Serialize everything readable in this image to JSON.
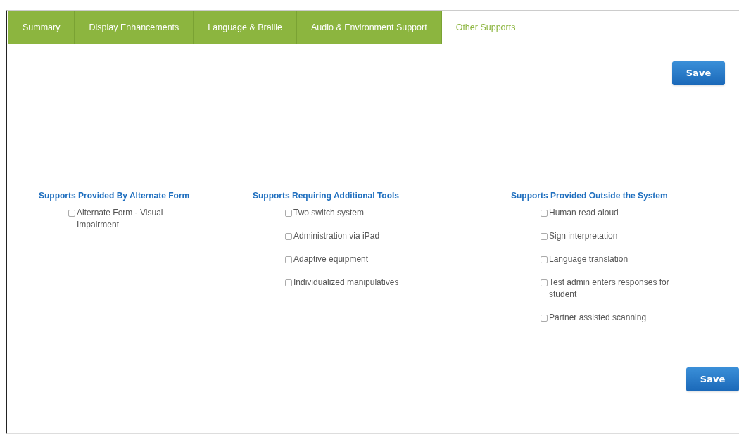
{
  "tabs": [
    {
      "label": "Summary",
      "selected": false
    },
    {
      "label": "Display Enhancements",
      "selected": false
    },
    {
      "label": "Language & Braille",
      "selected": false
    },
    {
      "label": "Audio & Environment Support",
      "selected": false
    },
    {
      "label": "Other Supports",
      "selected": true
    }
  ],
  "top_button": "Save",
  "groups": [
    {
      "heading": "Supports Provided By Alternate Form",
      "items": [
        {
          "label": "Alternate Form - Visual Impairment",
          "checked": false
        }
      ]
    },
    {
      "heading": "Supports Requiring Additional Tools",
      "items": [
        {
          "label": "Two switch system",
          "checked": false
        },
        {
          "label": "Administration via iPad",
          "checked": false
        },
        {
          "label": "Adaptive equipment",
          "checked": false
        },
        {
          "label": "Individualized manipulatives",
          "checked": false
        }
      ]
    },
    {
      "heading": "Supports Provided Outside the System",
      "items": [
        {
          "label": "Human read aloud",
          "checked": false
        },
        {
          "label": "Sign interpretation",
          "checked": false
        },
        {
          "label": "Language translation",
          "checked": false
        },
        {
          "label": "Test admin enters responses for student",
          "checked": false
        },
        {
          "label": "Partner assisted scanning",
          "checked": false
        }
      ]
    }
  ],
  "bottom_button": "Save"
}
